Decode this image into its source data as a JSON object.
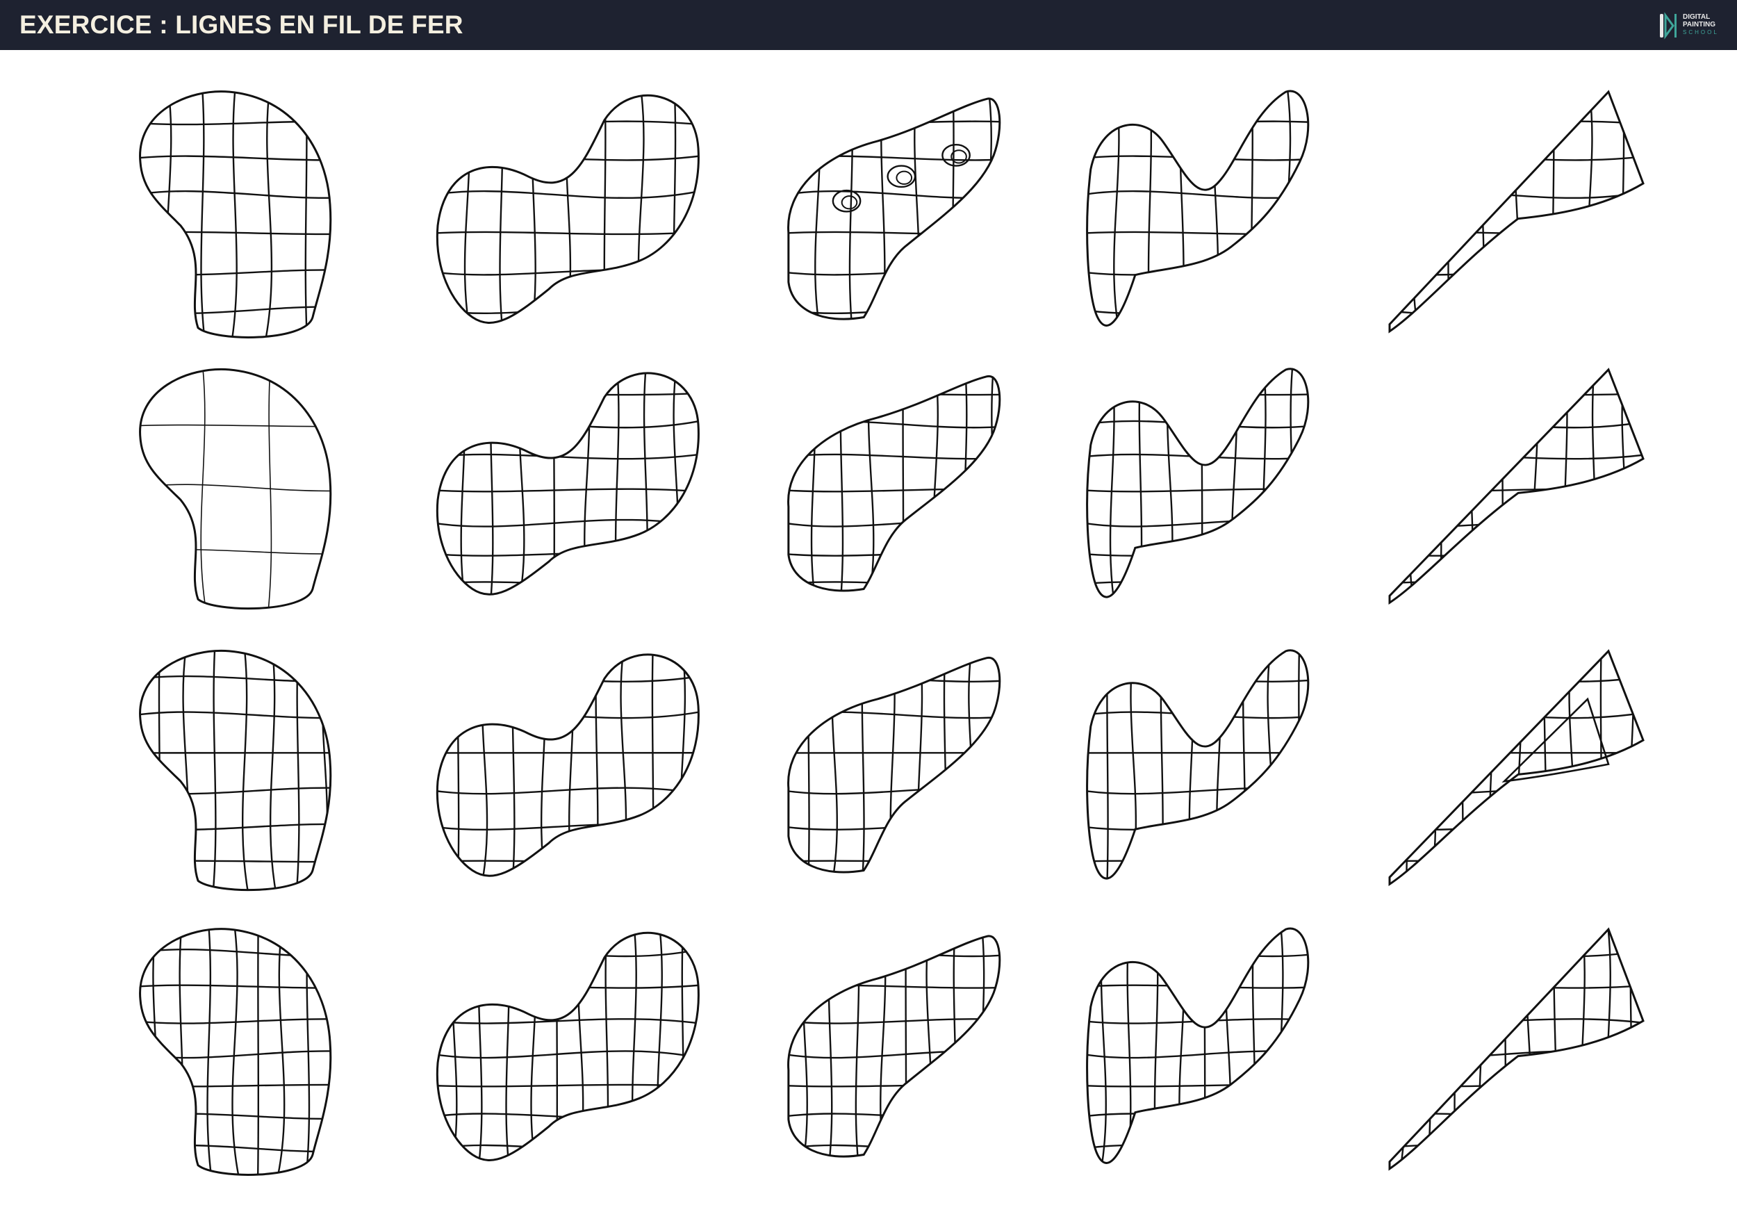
{
  "header": {
    "title": "EXERCICE : LIGNES EN FIL DE FER",
    "bg_color": "#1e2230",
    "title_color": "#f4efe0"
  },
  "logo": {
    "line1": "DIGITAL",
    "line2": "PAINTING",
    "line3": "SCHOOL",
    "accent_color": "#3fa69a"
  },
  "grid": {
    "rows": 4,
    "columns": 5,
    "shapes": [
      "blob",
      "snake",
      "slab",
      "hook",
      "wedge"
    ]
  }
}
